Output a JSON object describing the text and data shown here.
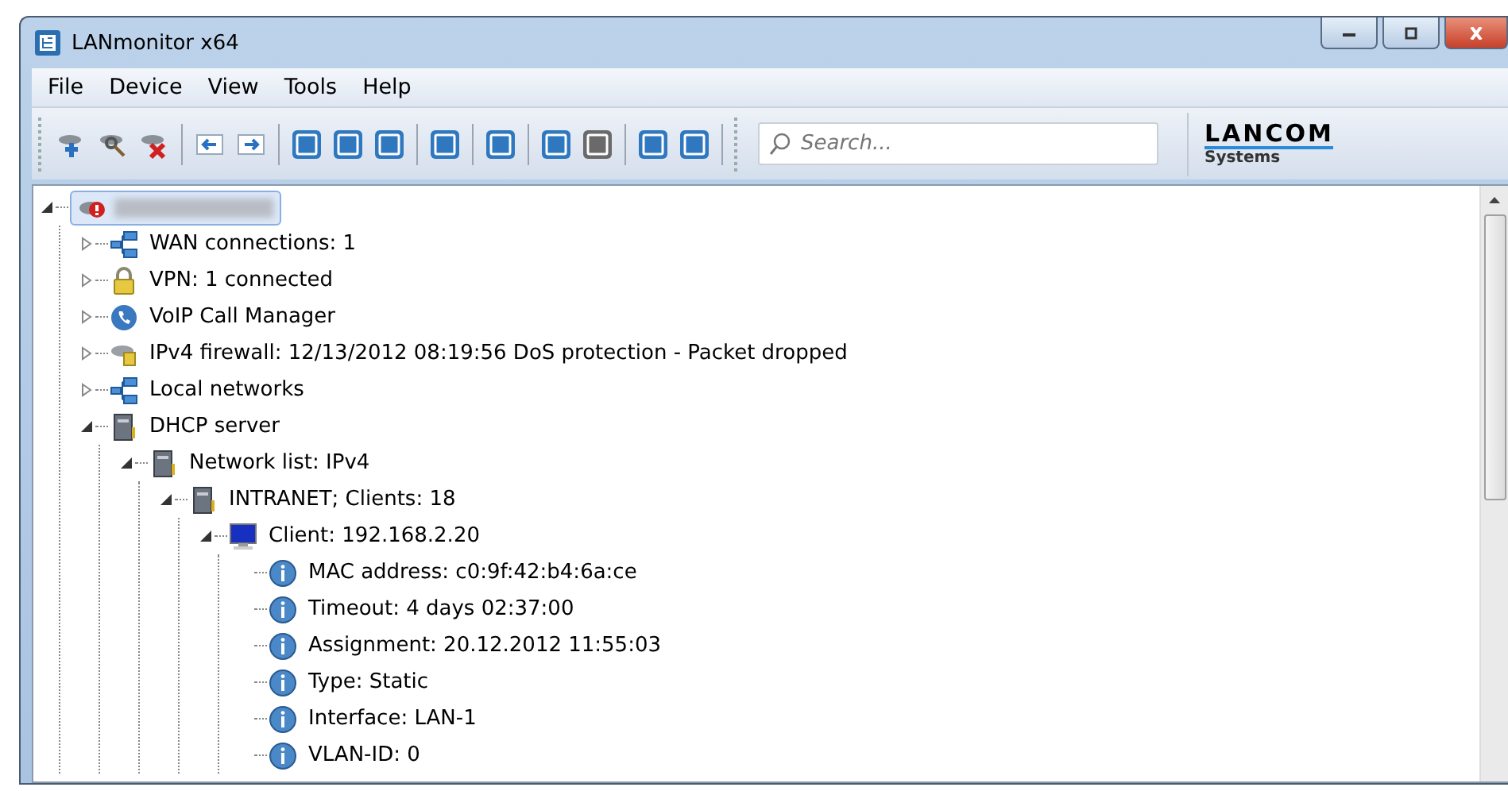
{
  "window": {
    "title": "LANmonitor x64"
  },
  "menu": [
    "File",
    "Device",
    "View",
    "Tools",
    "Help"
  ],
  "search": {
    "placeholder": "Search..."
  },
  "logo": {
    "name": "LANCOM",
    "sub": "Systems"
  },
  "tree": [
    {
      "kind": "router",
      "label_blurred": true,
      "selected": true,
      "expanded": true,
      "children": [
        {
          "kind": "network",
          "label": "WAN connections: 1",
          "expanded": false
        },
        {
          "kind": "lock",
          "label": "VPN: 1 connected",
          "expanded": false
        },
        {
          "kind": "phone",
          "label": "VoIP Call Manager",
          "expanded": false
        },
        {
          "kind": "firewall",
          "label": "IPv4 firewall: 12/13/2012 08:19:56 DoS protection - Packet dropped",
          "expanded": false
        },
        {
          "kind": "network",
          "label": "Local networks",
          "expanded": false
        },
        {
          "kind": "server",
          "label": "DHCP server",
          "expanded": true,
          "children": [
            {
              "kind": "server",
              "label": "Network list: IPv4",
              "expanded": true,
              "children": [
                {
                  "kind": "server",
                  "label": "INTRANET; Clients: 18",
                  "expanded": true,
                  "children": [
                    {
                      "kind": "monitor",
                      "label": "Client: 192.168.2.20",
                      "expanded": true,
                      "children": [
                        {
                          "kind": "info",
                          "label": "MAC address: c0:9f:42:b4:6a:ce"
                        },
                        {
                          "kind": "info",
                          "label": "Timeout: 4 days 02:37:00"
                        },
                        {
                          "kind": "info",
                          "label": "Assignment: 20.12.2012 11:55:03"
                        },
                        {
                          "kind": "info",
                          "label": "Type: Static"
                        },
                        {
                          "kind": "info",
                          "label": "Interface: LAN-1"
                        },
                        {
                          "kind": "info",
                          "label": "VLAN-ID: 0"
                        }
                      ]
                    }
                  ]
                }
              ]
            }
          ]
        }
      ]
    }
  ]
}
